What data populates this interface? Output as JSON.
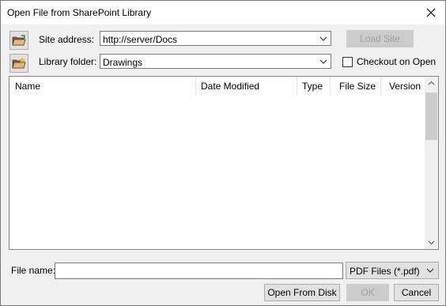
{
  "window": {
    "title": "Open File from SharePoint Library"
  },
  "icons": {
    "close": "close-icon",
    "site": "folder-open-icon",
    "library": "folder-star-icon",
    "dropdown": "chevron-down-icon",
    "scroll_up": "chevron-up-icon",
    "scroll_down": "chevron-down-icon"
  },
  "site": {
    "label": "Site address:",
    "value": "http://server/Docs",
    "load_button": "Load Site"
  },
  "library": {
    "label": "Library folder:",
    "value": "Drawings",
    "checkout_label": "Checkout on Open"
  },
  "list": {
    "columns": [
      "Name",
      "Date Modified",
      "Type",
      "File Size",
      "Version"
    ],
    "rows": []
  },
  "footer": {
    "file_name_label": "File name:",
    "file_name_value": "",
    "filter_value": "PDF Files (*.pdf)",
    "open_from_disk": "Open From Disk",
    "ok": "OK",
    "cancel": "Cancel"
  },
  "colors": {
    "folder": "#a0522d",
    "folder_light": "#deb887",
    "star": "#ffd700"
  }
}
